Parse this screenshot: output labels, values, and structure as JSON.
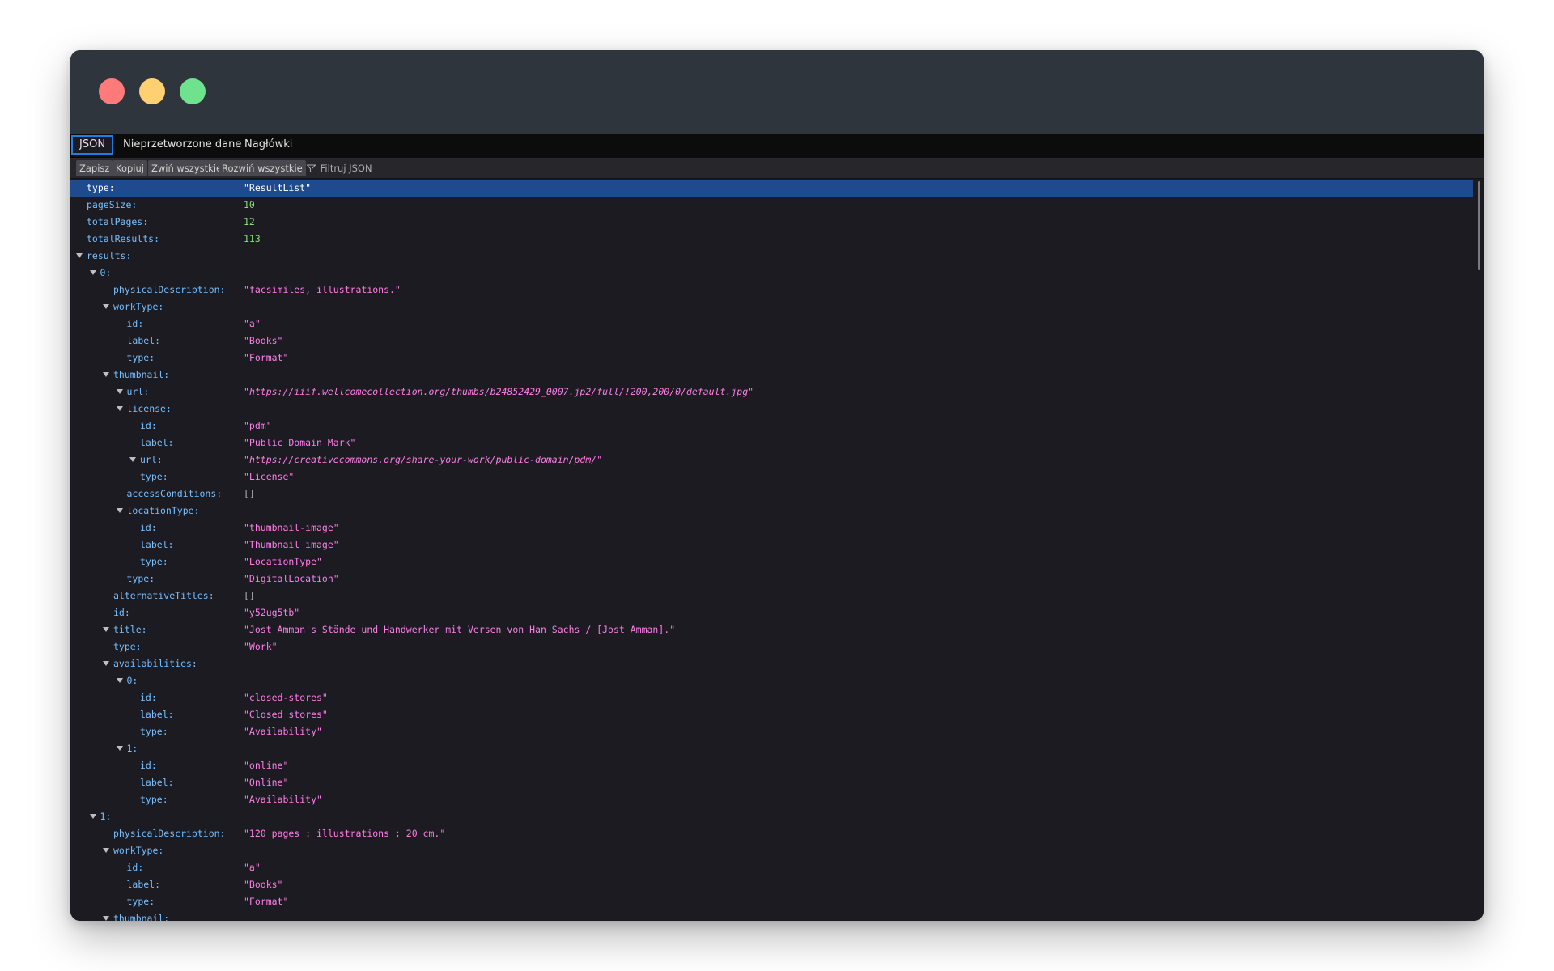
{
  "window": {
    "controls": [
      {
        "name": "close-dot",
        "color": "#ff7b7b"
      },
      {
        "name": "minimize-dot",
        "color": "#ffd071"
      },
      {
        "name": "maximize-dot",
        "color": "#6fe28d"
      }
    ]
  },
  "tabs": [
    "JSON",
    "Nieprzetworzone dane",
    "Nagłówki"
  ],
  "active_tab": "JSON",
  "toolbar": {
    "save": "Zapisz",
    "copy": "Kopiuj",
    "collapse_all": "Zwiń wszystkie",
    "expand_all": "Rozwiń wszystkie",
    "filter_placeholder": "Filtruj JSON",
    "filter_icon": "funnel-icon"
  },
  "colors": {
    "key": "#75bfff",
    "string": "#ff7de9",
    "number": "#86de74",
    "selected_row": "#1f4b8e"
  },
  "rows": [
    {
      "depth": 0,
      "key": "type:",
      "value": "\"ResultList\"",
      "kind": "str",
      "selected": true
    },
    {
      "depth": 0,
      "key": "pageSize:",
      "value": "10",
      "kind": "num"
    },
    {
      "depth": 0,
      "key": "totalPages:",
      "value": "12",
      "kind": "num"
    },
    {
      "depth": 0,
      "key": "totalResults:",
      "value": "113",
      "kind": "num"
    },
    {
      "depth": 0,
      "key": "results:",
      "value": "",
      "kind": "obj",
      "expanded": true
    },
    {
      "depth": 1,
      "key": "0:",
      "value": "",
      "kind": "obj",
      "expanded": true
    },
    {
      "depth": 2,
      "key": "physicalDescription:",
      "value": "\"facsimiles, illustrations.\"",
      "kind": "str"
    },
    {
      "depth": 2,
      "key": "workType:",
      "value": "",
      "kind": "obj",
      "expanded": true
    },
    {
      "depth": 3,
      "key": "id:",
      "value": "\"a\"",
      "kind": "str"
    },
    {
      "depth": 3,
      "key": "label:",
      "value": "\"Books\"",
      "kind": "str"
    },
    {
      "depth": 3,
      "key": "type:",
      "value": "\"Format\"",
      "kind": "str"
    },
    {
      "depth": 2,
      "key": "thumbnail:",
      "value": "",
      "kind": "obj",
      "expanded": true
    },
    {
      "depth": 3,
      "key": "url:",
      "value": "https://iiif.wellcomecollection.org/thumbs/b24852429_0007.jp2/full/!200,200/0/default.jpg",
      "kind": "link",
      "expanded": true
    },
    {
      "depth": 3,
      "key": "license:",
      "value": "",
      "kind": "obj",
      "expanded": true
    },
    {
      "depth": 4,
      "key": "id:",
      "value": "\"pdm\"",
      "kind": "str"
    },
    {
      "depth": 4,
      "key": "label:",
      "value": "\"Public Domain Mark\"",
      "kind": "str"
    },
    {
      "depth": 4,
      "key": "url:",
      "value": "https://creativecommons.org/share-your-work/public-domain/pdm/",
      "kind": "link",
      "expanded": true
    },
    {
      "depth": 4,
      "key": "type:",
      "value": "\"License\"",
      "kind": "str"
    },
    {
      "depth": 3,
      "key": "accessConditions:",
      "value": "[]",
      "kind": "arr"
    },
    {
      "depth": 3,
      "key": "locationType:",
      "value": "",
      "kind": "obj",
      "expanded": true
    },
    {
      "depth": 4,
      "key": "id:",
      "value": "\"thumbnail-image\"",
      "kind": "str"
    },
    {
      "depth": 4,
      "key": "label:",
      "value": "\"Thumbnail image\"",
      "kind": "str"
    },
    {
      "depth": 4,
      "key": "type:",
      "value": "\"LocationType\"",
      "kind": "str"
    },
    {
      "depth": 3,
      "key": "type:",
      "value": "\"DigitalLocation\"",
      "kind": "str"
    },
    {
      "depth": 2,
      "key": "alternativeTitles:",
      "value": "[]",
      "kind": "arr"
    },
    {
      "depth": 2,
      "key": "id:",
      "value": "\"y52ug5tb\"",
      "kind": "str"
    },
    {
      "depth": 2,
      "key": "title:",
      "value": "\"Jost Amman's Stände und Handwerker mit Versen von Han Sachs / [Jost Amman].\"",
      "kind": "str",
      "expanded": true
    },
    {
      "depth": 2,
      "key": "type:",
      "value": "\"Work\"",
      "kind": "str"
    },
    {
      "depth": 2,
      "key": "availabilities:",
      "value": "",
      "kind": "obj",
      "expanded": true
    },
    {
      "depth": 3,
      "key": "0:",
      "value": "",
      "kind": "obj",
      "expanded": true
    },
    {
      "depth": 4,
      "key": "id:",
      "value": "\"closed-stores\"",
      "kind": "str"
    },
    {
      "depth": 4,
      "key": "label:",
      "value": "\"Closed stores\"",
      "kind": "str"
    },
    {
      "depth": 4,
      "key": "type:",
      "value": "\"Availability\"",
      "kind": "str"
    },
    {
      "depth": 3,
      "key": "1:",
      "value": "",
      "kind": "obj",
      "expanded": true
    },
    {
      "depth": 4,
      "key": "id:",
      "value": "\"online\"",
      "kind": "str"
    },
    {
      "depth": 4,
      "key": "label:",
      "value": "\"Online\"",
      "kind": "str"
    },
    {
      "depth": 4,
      "key": "type:",
      "value": "\"Availability\"",
      "kind": "str"
    },
    {
      "depth": 1,
      "key": "1:",
      "value": "",
      "kind": "obj",
      "expanded": true
    },
    {
      "depth": 2,
      "key": "physicalDescription:",
      "value": "\"120 pages : illustrations ; 20 cm.\"",
      "kind": "str"
    },
    {
      "depth": 2,
      "key": "workType:",
      "value": "",
      "kind": "obj",
      "expanded": true
    },
    {
      "depth": 3,
      "key": "id:",
      "value": "\"a\"",
      "kind": "str"
    },
    {
      "depth": 3,
      "key": "label:",
      "value": "\"Books\"",
      "kind": "str"
    },
    {
      "depth": 3,
      "key": "type:",
      "value": "\"Format\"",
      "kind": "str"
    },
    {
      "depth": 2,
      "key": "thumbnail:",
      "value": "",
      "kind": "obj",
      "expanded": true
    }
  ]
}
